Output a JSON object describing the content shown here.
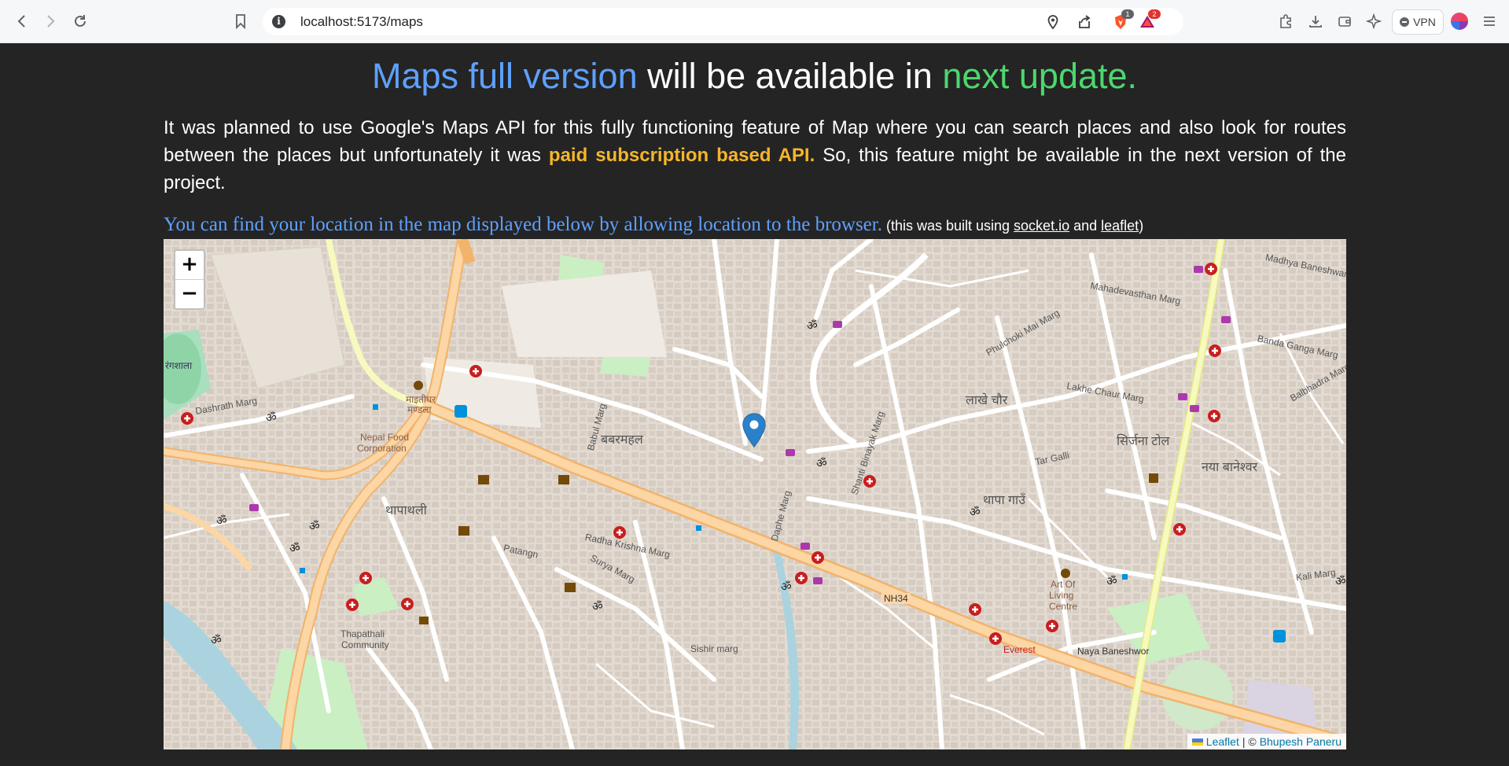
{
  "browser": {
    "url": "localhost:5173/maps",
    "brave_badge_count": "1",
    "rewards_badge_count": "2",
    "vpn_label": "VPN"
  },
  "heading": {
    "part1": "Maps full version",
    "part2": " will be available in ",
    "part3": "next update."
  },
  "intro": {
    "text_before": "It was planned to use Google's Maps API for this fully functioning feature of Map where you can search places and also look for routes between the places but unfortunately it was ",
    "highlight": "paid subscription based API.",
    "text_after": " So, this feature might be available in the next version of the project."
  },
  "location_note": {
    "main": "You can find your location in the map displayed below by allowing location to the browser.",
    "paren_open": " (this was built using ",
    "link1": "socket.io",
    "and": " and ",
    "link2": "leaflet",
    "paren_close": ")"
  },
  "map": {
    "zoom_in": "+",
    "zoom_out": "−",
    "attribution": {
      "leaflet": "Leaflet",
      "separator": " | © ",
      "author": "Bhupesh Paneru"
    },
    "labels": {
      "nepal_food": "Nepal Food",
      "corporation": "Corporation",
      "thapathali": "थापाथली",
      "babarmahal": "बबरमहल",
      "naya_baneshwor": "नया बानेश्वर",
      "thapagaun": "थापा गाउँ",
      "nh34": "NH34",
      "art_of_living": "Art Of",
      "living": "Living",
      "centre": "Centre",
      "everest": "Everest",
      "naya_baneshwor_en": "Naya Baneshwor",
      "dashrath_marg": "Dashrath Marg",
      "radha_krishna": "Radha Krishna Marg",
      "tar_galli": "Tar Galli",
      "kali_marg": "Kali Marg",
      "banda_ganga": "Banda Ganga Marg",
      "sirjana_tol": "सिर्जना टोल",
      "lakhe_chaur": "लाखे चौर",
      "thapathali_comm": "Thapathali",
      "community": "Community",
      "sishir": "Sishir marg",
      "patangn": "Patangn",
      "surya_marg": "Surya Marg",
      "mahadevasthan": "Mahadevasthan Marg",
      "madhya_baneshwar": "Madhya Baneshwar Marg",
      "balbhadra": "Balbhadra Marg",
      "lakhe_chaur_marg": "Lakhe Chaur Marg",
      "phulchoki": "Phulchoki Mai Marg",
      "babul_marg": "Babul Marg",
      "shanti_binayak": "Shanti Binayak Marg",
      "daphe_marg": "Daphe Marg",
      "rangshala": "रंगशाला",
      "maitighar": "माइतीघर",
      "mandala": "मण्डला"
    }
  }
}
